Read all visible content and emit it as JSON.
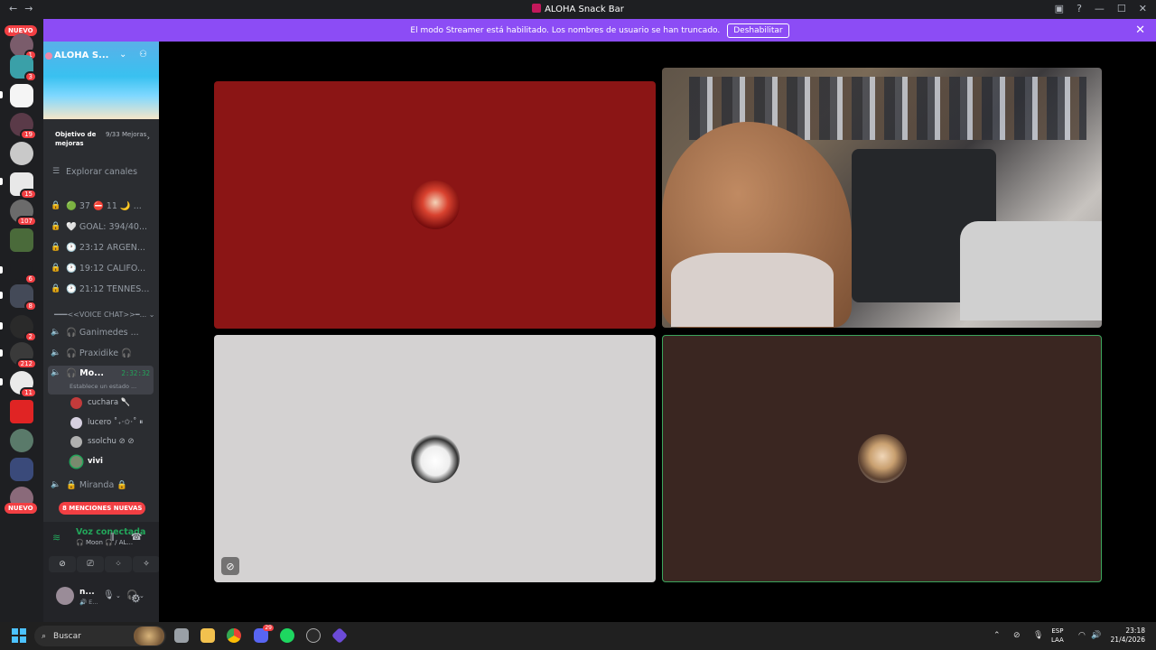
{
  "window": {
    "title": "ALOHA Snack Bar",
    "back": "←",
    "forward": "→"
  },
  "banner": {
    "text": "El modo Streamer está habilitado. Los nombres de usuario se han truncado.",
    "button": "Deshabilitar",
    "close": "✕"
  },
  "guilds": {
    "new_top": "NUEVO",
    "new_bottom": "NUEVO",
    "badges": [
      "1",
      "3",
      "19",
      "15",
      "107",
      "6",
      "8",
      "2",
      "212",
      "11"
    ]
  },
  "server": {
    "name": "ALOHA S...",
    "chevron": "⌄",
    "boost_title": "Objetivo de mejoras",
    "boost_count": "9/33 Mejoras",
    "boost_arrow": "›",
    "explore": "Explorar canales"
  },
  "channels": [
    {
      "icon": "🔒",
      "label": "🟢 37 ⛔ 11 🌙 ..."
    },
    {
      "icon": "🔒",
      "label": "🤍 GOAL: 394/40..."
    },
    {
      "icon": "🔒",
      "label": "🕐 23:12 ARGEN..."
    },
    {
      "icon": "🔒",
      "label": "🕐 19:12 CALIFO..."
    },
    {
      "icon": "🔒",
      "label": "🕐 21:12 TENNES..."
    }
  ],
  "category": "━━━<<VOICE CHAT>>━... ⌄",
  "voice_channels": [
    {
      "label": "🎧 Ganimedes ..."
    },
    {
      "label": "🎧 Praxidike 🎧"
    }
  ],
  "active_voice": {
    "label": "🎧 Mo...",
    "timer": "2:32:32",
    "status": "Establece un estado ..."
  },
  "voice_users": [
    {
      "name": "cuchara 🥄",
      "color": "#c23b3b"
    },
    {
      "name": "lucero ˚₊‧✩‧˚ ⏸",
      "color": "#d6d0e0"
    },
    {
      "name": "ssolchu ⊘ ⊘",
      "color": "#b0b0b0"
    },
    {
      "name": "vivi",
      "color": "#7a8a6e"
    }
  ],
  "locked_channel": "🔒 Miranda 🔒",
  "mentions": "8 MENCIONES NUEVAS",
  "voice_bar": {
    "connected": "Voz conectada",
    "sub": "🎧 Moon 🎧 / AL..."
  },
  "user": {
    "name": "n...",
    "status": "🔊 E..."
  },
  "tiles": {
    "colors": {
      "red": "#8b1515",
      "grey": "#d4d2d2",
      "brown": "#3a2621",
      "speaking_border": "#3ba55c"
    }
  },
  "taskbar": {
    "search": "Buscar",
    "lang_top": "ESP",
    "lang_bottom": "LAA",
    "time": "23:18",
    "date": "21/4/2026",
    "discord_badge": "29"
  }
}
